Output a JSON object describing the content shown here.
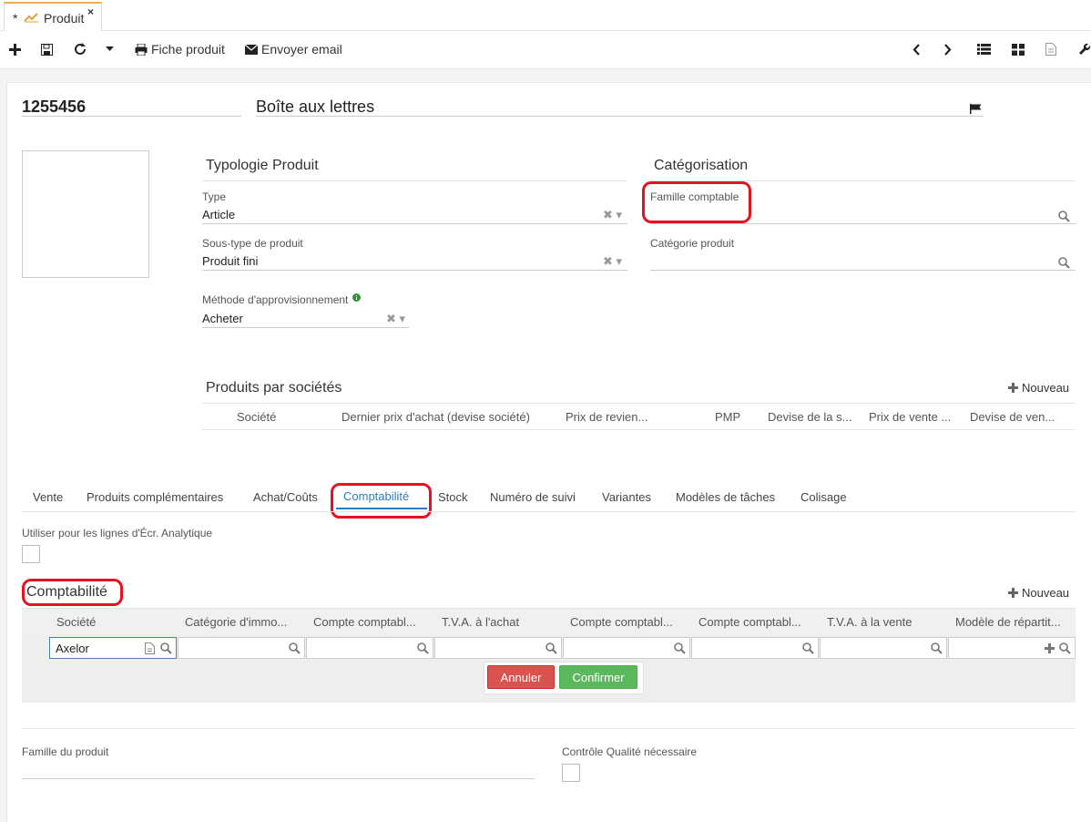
{
  "tab": {
    "modified_mark": "*",
    "title": "Produit",
    "close": "×"
  },
  "toolbar": {
    "print_label": "Fiche produit",
    "email_label": "Envoyer email"
  },
  "header": {
    "code": "1255456",
    "name": "Boîte aux lettres"
  },
  "typologie": {
    "title": "Typologie Produit",
    "type_label": "Type",
    "type_value": "Article",
    "subtype_label": "Sous-type de produit",
    "subtype_value": "Produit fini",
    "method_label": "Méthode d'approvisionnement",
    "method_value": "Acheter"
  },
  "categorisation": {
    "title": "Catégorisation",
    "famille_label": "Famille comptable",
    "categorie_label": "Catégorie produit"
  },
  "companies": {
    "title": "Produits par sociétés",
    "new_label": "Nouveau",
    "columns": [
      "Société",
      "Dernier prix d'achat (devise société)",
      "Prix de revien...",
      "PMP",
      "Devise de la s...",
      "Prix de vente ...",
      "Devise de ven..."
    ]
  },
  "tabs": [
    "Vente",
    "Produits complémentaires",
    "Achat/Coûts",
    "Comptabilité",
    "Stock",
    "Numéro de suivi",
    "Variantes",
    "Modèles de tâches",
    "Colisage"
  ],
  "active_tab": "Comptabilité",
  "comptabilite": {
    "analytic_label": "Utiliser pour les lignes d'Écr. Analytique",
    "title": "Comptabilité",
    "new_label": "Nouveau",
    "columns": [
      "Société",
      "Catégorie d'immo...",
      "Compte comptabl...",
      "T.V.A. à l'achat",
      "Compte comptabl...",
      "Compte comptabl...",
      "T.V.A. à la vente",
      "Modèle de répartit..."
    ],
    "societe_value": "Axelor",
    "cancel_label": "Annuler",
    "confirm_label": "Confirmer"
  },
  "footer": {
    "famille_produit_label": "Famille du produit",
    "qualite_label": "Contrôle Qualité nécessaire"
  },
  "colors": {
    "annuler": "#d9534f",
    "confirmer": "#5cb85c",
    "accent": "#2b7fc1",
    "highlight": "#e1141f"
  }
}
